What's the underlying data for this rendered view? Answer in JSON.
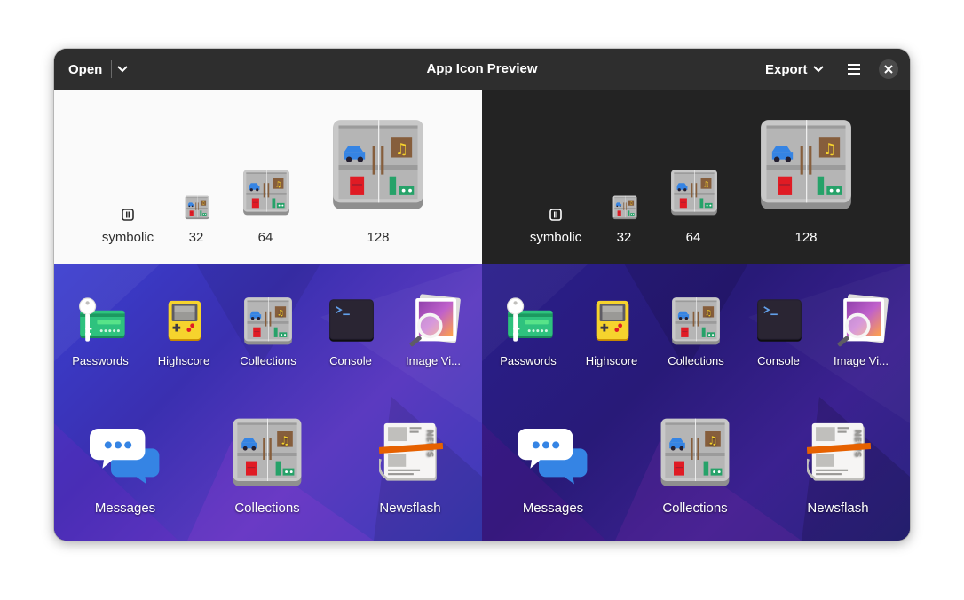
{
  "window": {
    "title": "App Icon Preview",
    "open_label": "Open",
    "open_mnemonic": "O",
    "open_rest": "pen",
    "export_label": "Export",
    "export_mnemonic": "E",
    "export_rest": "xport"
  },
  "sizes": [
    "symbolic",
    "32",
    "64",
    "128"
  ],
  "light_panel": {
    "labels": [
      "symbolic",
      "32",
      "64",
      "128"
    ]
  },
  "dark_panel": {
    "labels": [
      "symbolic",
      "32",
      "64",
      "128"
    ]
  },
  "small_apps": [
    "Passwords",
    "Highscore",
    "Collections",
    "Console",
    "Image Vi..."
  ],
  "large_apps": [
    "Messages",
    "Collections",
    "Newsflash"
  ],
  "colors": {
    "headerbar": "#2e2e2e",
    "light_panel": "#fafafa",
    "dark_panel": "#232323",
    "accent_blue": "#3584e4"
  },
  "icons": [
    "menu-dropdown-chevron",
    "hamburger-menu-icon",
    "close-icon",
    "collections-icon",
    "passwords-icon",
    "highscore-icon",
    "console-icon",
    "image-viewer-icon",
    "messages-icon",
    "newsflash-icon"
  ]
}
